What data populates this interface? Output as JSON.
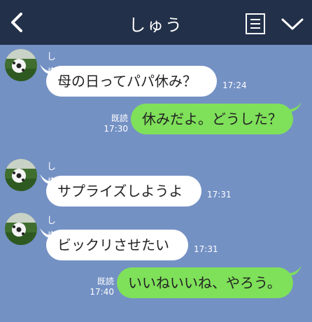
{
  "header": {
    "title": "しゅう",
    "back_icon": "chevron-left-icon",
    "menu_icon": "note-list-icon",
    "collapse_icon": "chevron-down-icon"
  },
  "colors": {
    "header_bg": "#223049",
    "chat_bg": "#7491c4",
    "incoming_bubble": "#ffffff",
    "outgoing_bubble": "#7fe05a"
  },
  "messages": [
    {
      "direction": "incoming",
      "sender": "しゅう",
      "text": "母の日ってパパ休み？",
      "time": "17:24"
    },
    {
      "direction": "outgoing",
      "read": "既読",
      "text": "休みだよ。どうした？",
      "time": "17:30"
    },
    {
      "direction": "incoming",
      "sender": "しゅう",
      "text": "サプライズしようよ",
      "time": "17:31"
    },
    {
      "direction": "incoming",
      "sender": "しゅう",
      "text": "ビックリさせたい",
      "time": "17:31"
    },
    {
      "direction": "outgoing",
      "read": "既読",
      "text": "いいねいいね、やろう。",
      "time": "17:40"
    }
  ]
}
